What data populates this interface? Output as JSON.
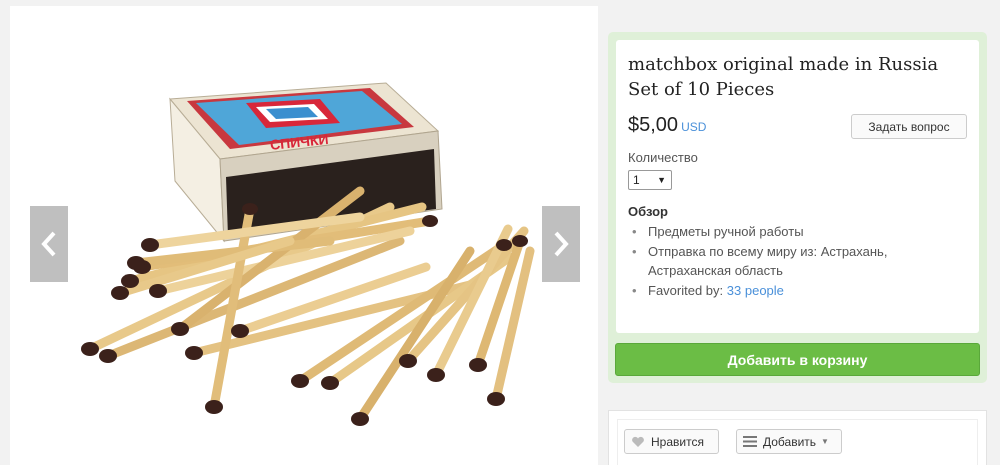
{
  "listing": {
    "title": "matchbox original made in Russia Set of 10 Pieces",
    "price": "$5,00",
    "currency": "USD",
    "ask_button": "Задать вопрос",
    "quantity_label": "Количество",
    "quantity_value": "1",
    "overview_title": "Обзор",
    "overview_items": [
      "Предметы ручной работы",
      "Отправка по всему миру из: Астрахань, Астраханская область"
    ],
    "favorited_prefix": "Favorited by:",
    "favorited_link": "33 people",
    "cart_button": "Добавить в корзину"
  },
  "photo": {
    "matchbox_label": "СПИЧКИ"
  },
  "actions": {
    "like_button": "Нравится",
    "add_button": "Добавить"
  },
  "icons": {
    "prev": "chevron-left-icon",
    "next": "chevron-right-icon",
    "like": "heart-icon",
    "add": "list-icon"
  },
  "colors": {
    "accent_green": "#6bbd45",
    "card_green": "#dff0d8",
    "link_blue": "#4a90d9"
  }
}
